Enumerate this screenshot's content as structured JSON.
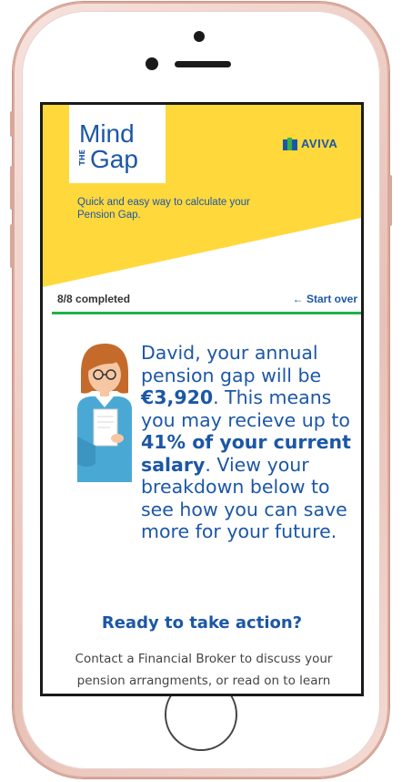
{
  "brand": {
    "logo_line1": "Mind",
    "logo_the": "THE",
    "logo_line2": "Gap",
    "partner_logo": "AVIVA",
    "tagline": "Quick and easy way to calculate your Pension Gap."
  },
  "progress": {
    "status_text": "8/8 completed",
    "completed": 8,
    "total": 8,
    "start_over_label": "Start over",
    "start_over_icon": "arrow-left-icon"
  },
  "result": {
    "part1": "David, your annual pension gap will be ",
    "gap_amount": "€3,920",
    "part2": ". This means you may recieve up to ",
    "percent_text": "41% of your current salary",
    "part3": ". View your breakdown below to see how you can save more for your future."
  },
  "cta": {
    "title": "Ready to take action?",
    "body": "Contact a Financial Broker to discuss your pension arrangments, or read on to learn"
  },
  "colors": {
    "brand_blue": "#1c57a6",
    "hero_yellow": "#ffd83b",
    "progress_green": "#20b24b",
    "phone_rose_gold": "#efcfc6"
  }
}
